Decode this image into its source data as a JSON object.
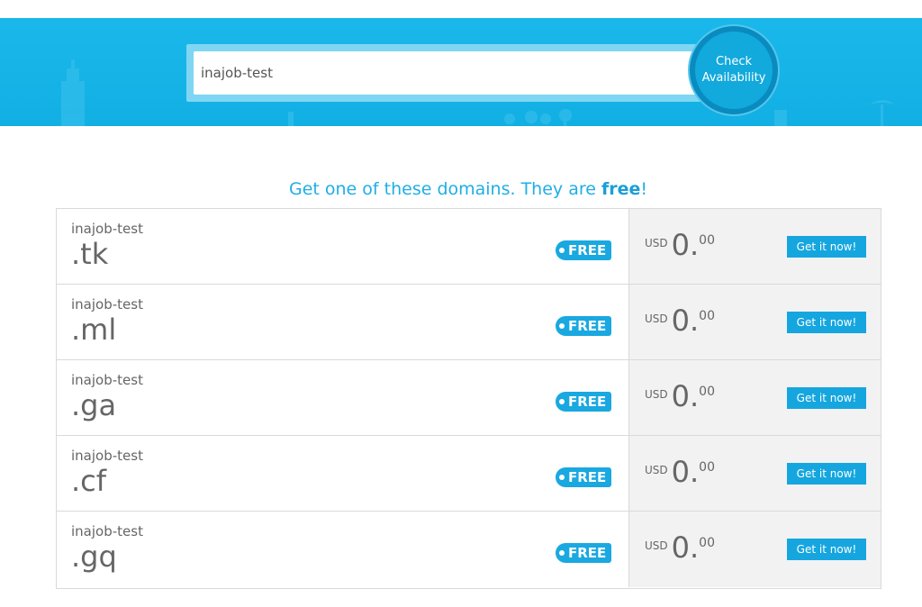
{
  "search": {
    "value": "inajob-test",
    "button_line1": "Check",
    "button_line2": "Availability"
  },
  "promo": {
    "text_before": "Get one of these domains. They are ",
    "text_bold": "free",
    "text_after": "!"
  },
  "colors": {
    "accent": "#1aa8e0",
    "hero": "#12afe4",
    "price_bg": "#f2f2f2"
  },
  "domains": [
    {
      "sld": "inajob-test",
      "tld": ".tk",
      "badge": "FREE",
      "currency": "USD",
      "whole": "0.",
      "cents": "00",
      "action": "Get it now!"
    },
    {
      "sld": "inajob-test",
      "tld": ".ml",
      "badge": "FREE",
      "currency": "USD",
      "whole": "0.",
      "cents": "00",
      "action": "Get it now!"
    },
    {
      "sld": "inajob-test",
      "tld": ".ga",
      "badge": "FREE",
      "currency": "USD",
      "whole": "0.",
      "cents": "00",
      "action": "Get it now!"
    },
    {
      "sld": "inajob-test",
      "tld": ".cf",
      "badge": "FREE",
      "currency": "USD",
      "whole": "0.",
      "cents": "00",
      "action": "Get it now!"
    },
    {
      "sld": "inajob-test",
      "tld": ".gq",
      "badge": "FREE",
      "currency": "USD",
      "whole": "0.",
      "cents": "00",
      "action": "Get it now!"
    }
  ]
}
